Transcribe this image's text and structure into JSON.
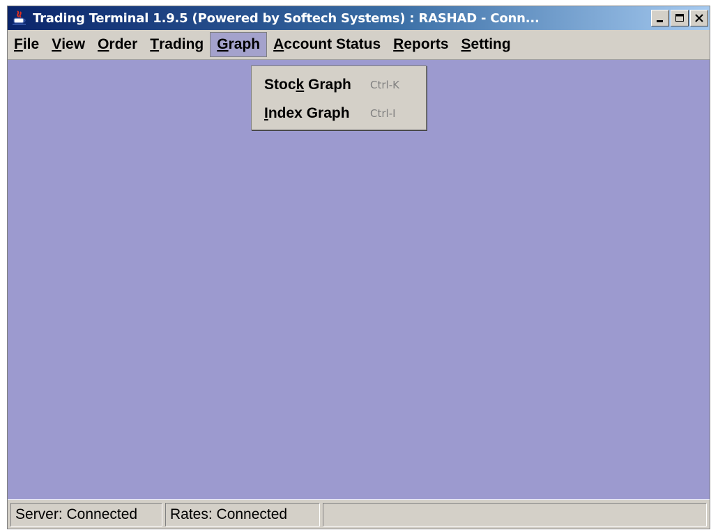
{
  "window": {
    "title": "Trading Terminal 1.9.5 (Powered by Softech Systems)   :   RASHAD - Conn...",
    "icon": "java-cup-icon",
    "controls": [
      "minimize-icon",
      "maximize-icon",
      "close-icon"
    ]
  },
  "menubar": {
    "items": [
      {
        "label": "File",
        "mnemonic": "F",
        "rest": "ile"
      },
      {
        "label": "View",
        "mnemonic": "V",
        "rest": "iew"
      },
      {
        "label": "Order",
        "mnemonic": "O",
        "rest": "rder"
      },
      {
        "label": "Trading",
        "mnemonic": "T",
        "rest": "rading"
      },
      {
        "label": "Graph",
        "mnemonic": "G",
        "rest": "raph"
      },
      {
        "label": "Account Status",
        "mnemonic": "A",
        "rest": "ccount Status"
      },
      {
        "label": "Reports",
        "mnemonic": "R",
        "rest": "eports"
      },
      {
        "label": "Setting",
        "mnemonic": "S",
        "rest": "etting"
      }
    ],
    "active": "Graph"
  },
  "graph_menu": {
    "items": [
      {
        "pre": "Stoc",
        "mnemonic": "k",
        "post": " Graph",
        "shortcut": "Ctrl-K"
      },
      {
        "pre": "",
        "mnemonic": "I",
        "post": "ndex Graph",
        "shortcut": "Ctrl-I"
      }
    ]
  },
  "statusbar": {
    "server": "Server: Connected",
    "rates": "Rates: Connected",
    "extra": ""
  },
  "colors": {
    "titlebar_start": "#0a246a",
    "titlebar_end": "#a6caf0",
    "desktop": "#9c9acf",
    "chrome": "#d4d0c8"
  }
}
